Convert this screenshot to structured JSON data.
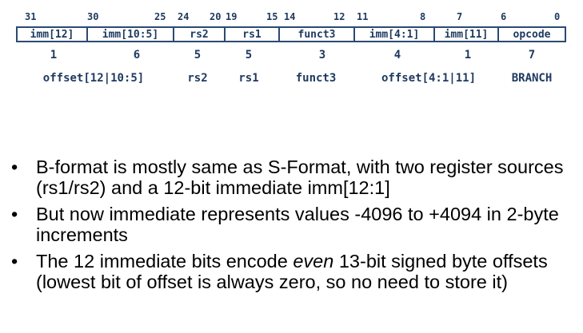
{
  "bit_positions": [
    "31",
    "30",
    "25",
    "24",
    "20",
    "19",
    "15",
    "14",
    "12",
    "11",
    "8",
    "7",
    "6",
    "0"
  ],
  "fields": [
    {
      "label": "imm[12]",
      "width": "1",
      "name": "offset[12|10:5]"
    },
    {
      "label": "imm[10:5]",
      "width": "6",
      "name": ""
    },
    {
      "label": "rs2",
      "width": "5",
      "name": "rs2"
    },
    {
      "label": "rs1",
      "width": "5",
      "name": "rs1"
    },
    {
      "label": "funct3",
      "width": "3",
      "name": "funct3"
    },
    {
      "label": "imm[4:1]",
      "width": "4",
      "name": "offset[4:1|11]"
    },
    {
      "label": "imm[11]",
      "width": "1",
      "name": ""
    },
    {
      "label": "opcode",
      "width": "7",
      "name": "BRANCH"
    }
  ],
  "bullets": [
    {
      "text": "B-format is mostly same as S-Format, with two register sources (rs1/rs2) and a 12-bit immediate imm[12:1]"
    },
    {
      "text": "But now immediate represents values -4096 to +4094 in 2-byte increments"
    },
    {
      "pre": "The 12 immediate bits encode ",
      "em": "even",
      "post": " 13-bit signed byte offsets (lowest bit of offset is always zero, so no need to store it)"
    }
  ],
  "bullet_glyph": "•",
  "colors": {
    "diagram_text": "#1f3a60",
    "diagram_border": "#2a4a73",
    "body_text": "#000000"
  }
}
